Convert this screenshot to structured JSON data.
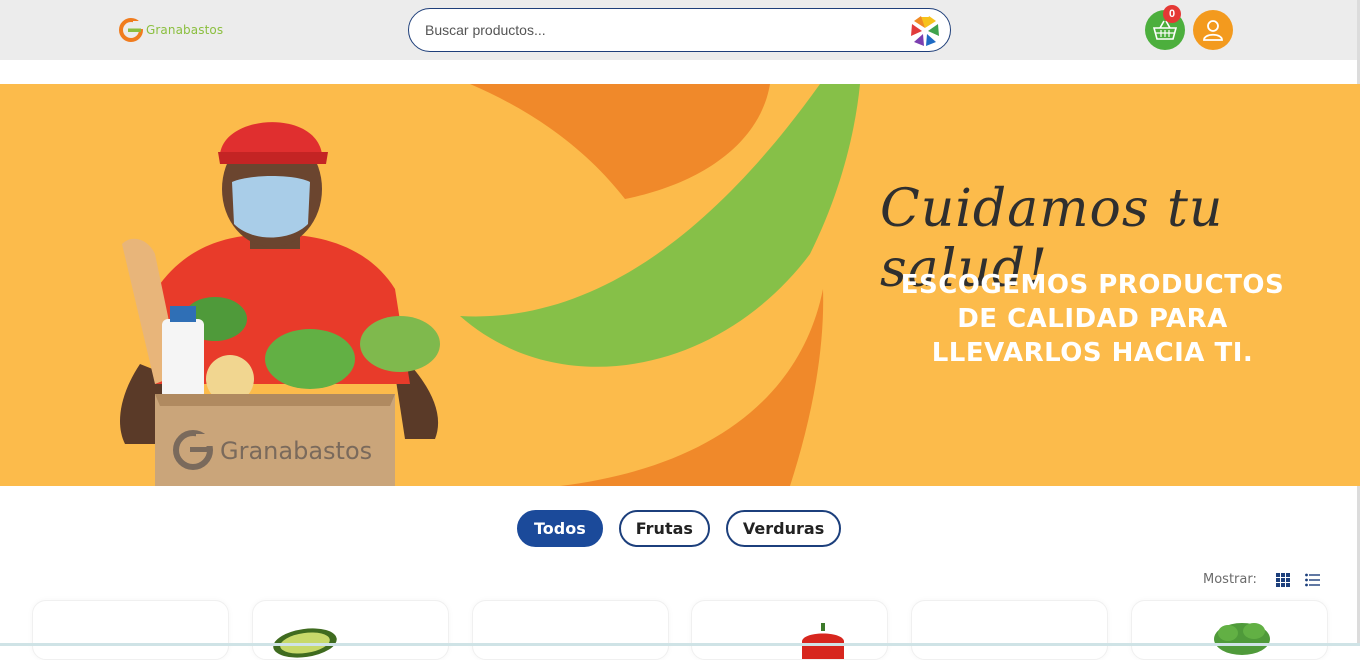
{
  "header": {
    "logo_text": "Granabastos",
    "search_placeholder": "Buscar productos...",
    "cart_count": "0",
    "icons": {
      "search": "colorful-flower-icon",
      "cart": "basket-icon",
      "user": "user-icon"
    },
    "colors": {
      "cart_bg": "#4caf3d",
      "user_bg": "#f39a1e",
      "badge_bg": "#e53935"
    }
  },
  "banner": {
    "headline": "Cuidamos tu salud!",
    "subline": "ESCOGEMOS PRODUCTOS DE CALIDAD PARA LLEVARLOS HACIA TI.",
    "box_brand": "Granabastos",
    "colors": {
      "background": "#fcbb4b",
      "orange": "#f0892a",
      "green": "#86c048"
    }
  },
  "filters": {
    "items": [
      {
        "label": "Todos",
        "active": true
      },
      {
        "label": "Frutas",
        "active": false
      },
      {
        "label": "Verduras",
        "active": false
      }
    ],
    "active_color": "#1b4a9a"
  },
  "view": {
    "label": "Mostrar:",
    "icons": [
      "grid-view-icon",
      "list-view-icon"
    ]
  },
  "products": [
    {
      "image": "empty"
    },
    {
      "image": "avocado"
    },
    {
      "image": "empty"
    },
    {
      "image": "red-pepper"
    },
    {
      "image": "empty"
    },
    {
      "image": "parsley"
    }
  ]
}
